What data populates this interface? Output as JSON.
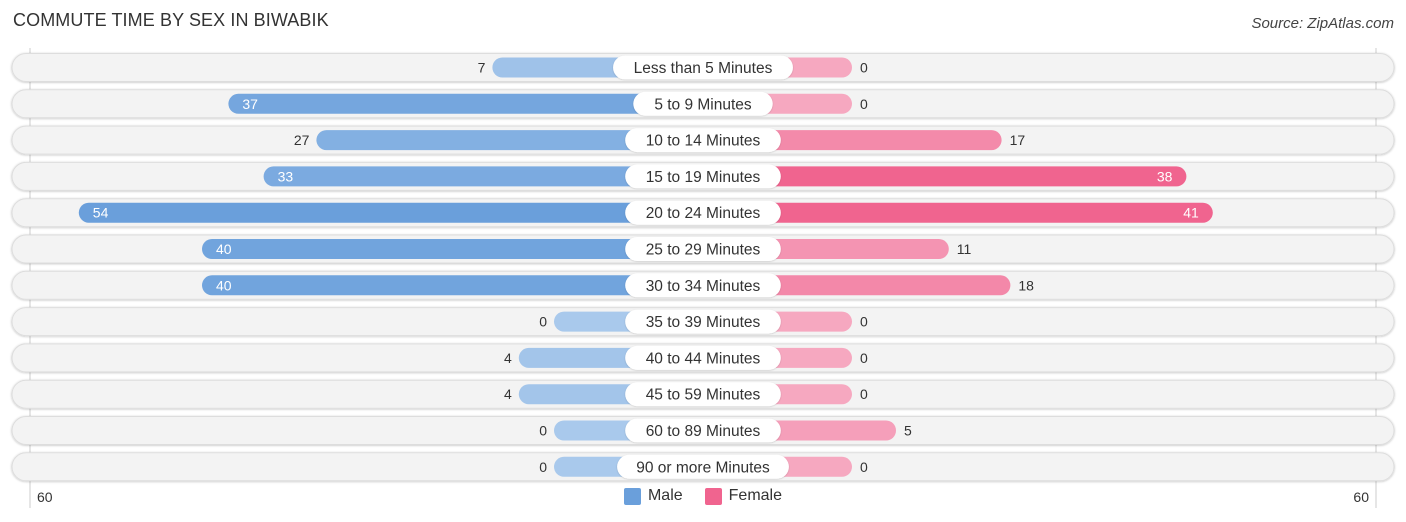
{
  "header": {
    "title": "COMMUTE TIME BY SEX IN BIWABIK",
    "source": "Source: ZipAtlas.com"
  },
  "colors": {
    "male_strong": "#6a9fdb",
    "male_light": "#a9c9ec",
    "female_strong": "#f0648f",
    "female_light": "#f6a8c0",
    "track": "#f3f3f3"
  },
  "chart_data": {
    "type": "bar",
    "orientation": "horizontal-diverging",
    "title": "COMMUTE TIME BY SEX IN BIWABIK",
    "categories": [
      "Less than 5 Minutes",
      "5 to 9 Minutes",
      "10 to 14 Minutes",
      "15 to 19 Minutes",
      "20 to 24 Minutes",
      "25 to 29 Minutes",
      "30 to 34 Minutes",
      "35 to 39 Minutes",
      "40 to 44 Minutes",
      "45 to 59 Minutes",
      "60 to 89 Minutes",
      "90 or more Minutes"
    ],
    "series": [
      {
        "name": "Male",
        "values": [
          7,
          37,
          27,
          33,
          54,
          40,
          40,
          0,
          4,
          4,
          0,
          0
        ]
      },
      {
        "name": "Female",
        "values": [
          0,
          0,
          17,
          38,
          41,
          11,
          18,
          0,
          0,
          0,
          5,
          0
        ]
      }
    ],
    "xlim": [
      60,
      60
    ],
    "axis_labels": {
      "left": "60",
      "right": "60"
    },
    "legend": {
      "position": "bottom-center",
      "entries": [
        "Male",
        "Female"
      ]
    },
    "grid": false
  }
}
